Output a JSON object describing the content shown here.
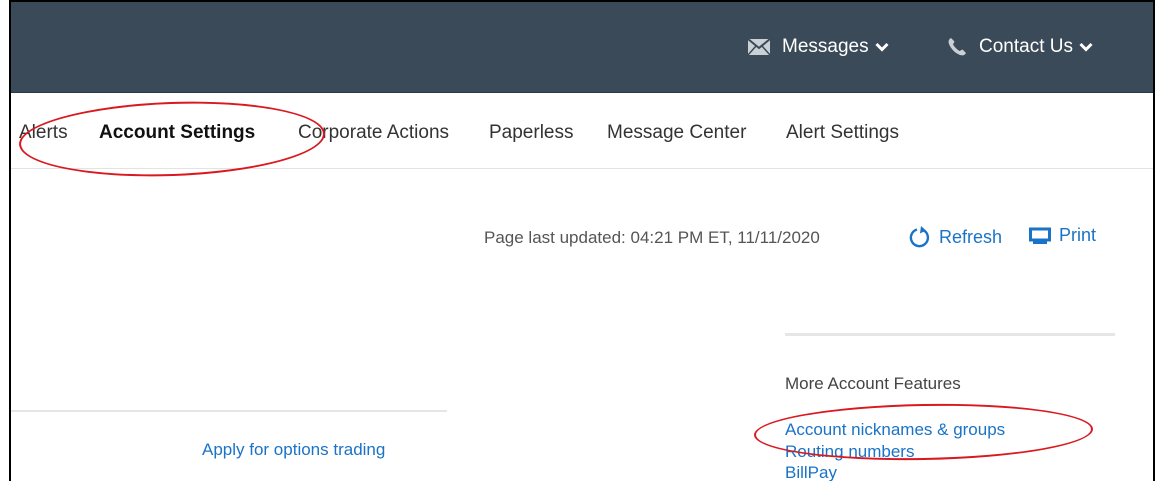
{
  "header": {
    "messages_label": "Messages",
    "contact_label": "Contact Us",
    "background_color": "#3b4a58"
  },
  "tabs": [
    {
      "label": "Alerts",
      "active": false
    },
    {
      "label": "Account Settings",
      "active": true
    },
    {
      "label": "Corporate Actions",
      "active": false
    },
    {
      "label": "Paperless",
      "active": false
    },
    {
      "label": "Message Center",
      "active": false
    },
    {
      "label": "Alert Settings",
      "active": false
    }
  ],
  "page": {
    "last_updated": "Page last updated: 04:21 PM ET, 11/11/2020",
    "refresh_label": "Refresh",
    "print_label": "Print"
  },
  "options_link": "Apply for options trading",
  "more_features": {
    "title": "More Account Features",
    "links": [
      "Account nicknames & groups",
      "Routing numbers",
      "BillPay"
    ]
  },
  "colors": {
    "link": "#1a73c7",
    "annotation": "#d9181f"
  },
  "icons": {
    "messages": "envelope-icon",
    "contact": "phone-icon",
    "chevron": "chevron-down-icon",
    "refresh": "refresh-icon",
    "print": "print-icon"
  }
}
